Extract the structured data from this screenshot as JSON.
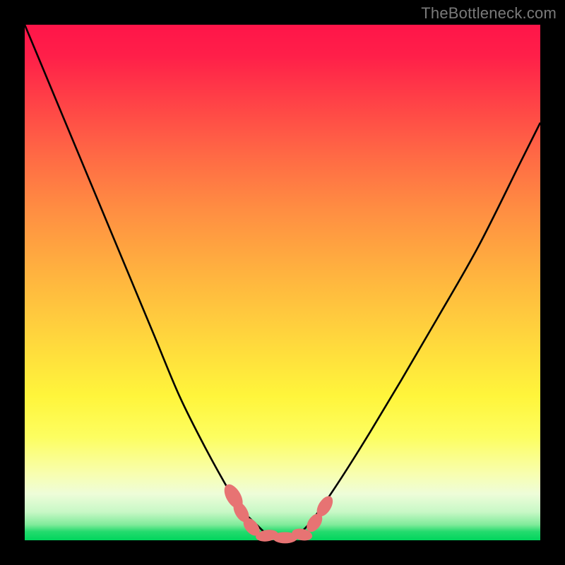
{
  "watermark": "TheBottleneck.com",
  "colors": {
    "frame": "#000000",
    "gradient_top": "#ff1549",
    "gradient_bottom": "#00d55d",
    "curve": "#000000",
    "marker_fill": "#e77373",
    "marker_stroke": "#c85858"
  },
  "chart_data": {
    "type": "line",
    "title": "",
    "xlabel": "",
    "ylabel": "",
    "xlim": [
      0,
      100
    ],
    "ylim": [
      0,
      100
    ],
    "grid": false,
    "legend": false,
    "series": [
      {
        "name": "bottleneck-curve",
        "x": [
          0,
          5,
          10,
          15,
          20,
          25,
          30,
          35,
          40,
          42,
          45,
          47,
          49,
          51,
          53,
          55,
          58,
          62,
          67,
          73,
          80,
          88,
          96,
          100
        ],
        "y": [
          100,
          88,
          76,
          64,
          52,
          40,
          28,
          18,
          9,
          6,
          3,
          1.2,
          0.5,
          0.5,
          1.2,
          3,
          7,
          13,
          21,
          31,
          43,
          57,
          73,
          81
        ]
      }
    ],
    "markers": [
      {
        "x": 40.5,
        "y": 8.5,
        "rx": 1.4,
        "ry": 2.6,
        "rot": -30
      },
      {
        "x": 42.0,
        "y": 5.5,
        "rx": 1.2,
        "ry": 2.2,
        "rot": -30
      },
      {
        "x": 44.0,
        "y": 2.6,
        "rx": 1.2,
        "ry": 2.0,
        "rot": -40
      },
      {
        "x": 47.0,
        "y": 0.9,
        "rx": 2.2,
        "ry": 1.1,
        "rot": -8
      },
      {
        "x": 50.5,
        "y": 0.5,
        "rx": 2.4,
        "ry": 1.1,
        "rot": 0
      },
      {
        "x": 53.8,
        "y": 1.1,
        "rx": 2.0,
        "ry": 1.1,
        "rot": 12
      },
      {
        "x": 56.2,
        "y": 3.4,
        "rx": 1.2,
        "ry": 2.0,
        "rot": 35
      },
      {
        "x": 58.2,
        "y": 6.6,
        "rx": 1.2,
        "ry": 2.2,
        "rot": 32
      }
    ]
  }
}
